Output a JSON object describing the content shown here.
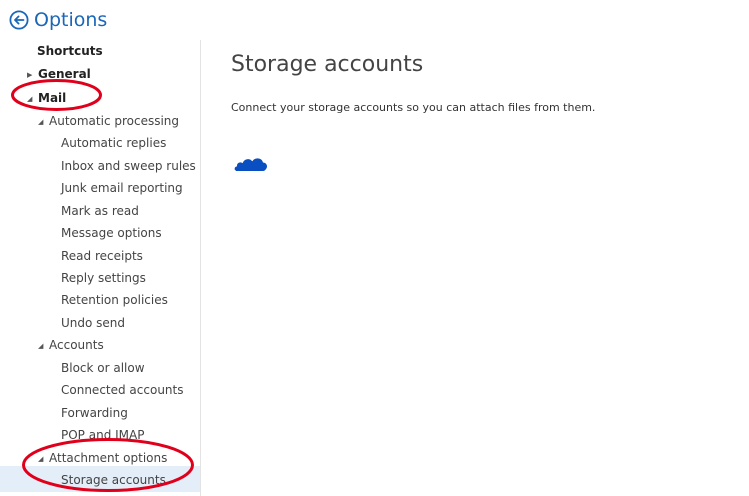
{
  "header": {
    "title": "Options",
    "back_icon": "back-arrow-circle-icon"
  },
  "sidebar": {
    "shortcuts": "Shortcuts",
    "general": "General",
    "mail": "Mail",
    "automatic_processing": {
      "label": "Automatic processing",
      "items": [
        "Automatic replies",
        "Inbox and sweep rules",
        "Junk email reporting",
        "Mark as read",
        "Message options",
        "Read receipts",
        "Reply settings",
        "Retention policies",
        "Undo send"
      ]
    },
    "accounts": {
      "label": "Accounts",
      "items": [
        "Block or allow",
        "Connected accounts",
        "Forwarding",
        "POP and IMAP"
      ]
    },
    "attachment_options": {
      "label": "Attachment options",
      "items": [
        "Storage accounts"
      ]
    },
    "selected": "Storage accounts"
  },
  "main": {
    "title": "Storage accounts",
    "description": "Connect your storage accounts so you can attach files from them.",
    "provider_icon": "onedrive-cloud-icon"
  },
  "colors": {
    "accent": "#1a66b8",
    "selected_background": "#e4eef8",
    "annotation": "#e0001b",
    "onedrive": "#0a4fc2"
  }
}
